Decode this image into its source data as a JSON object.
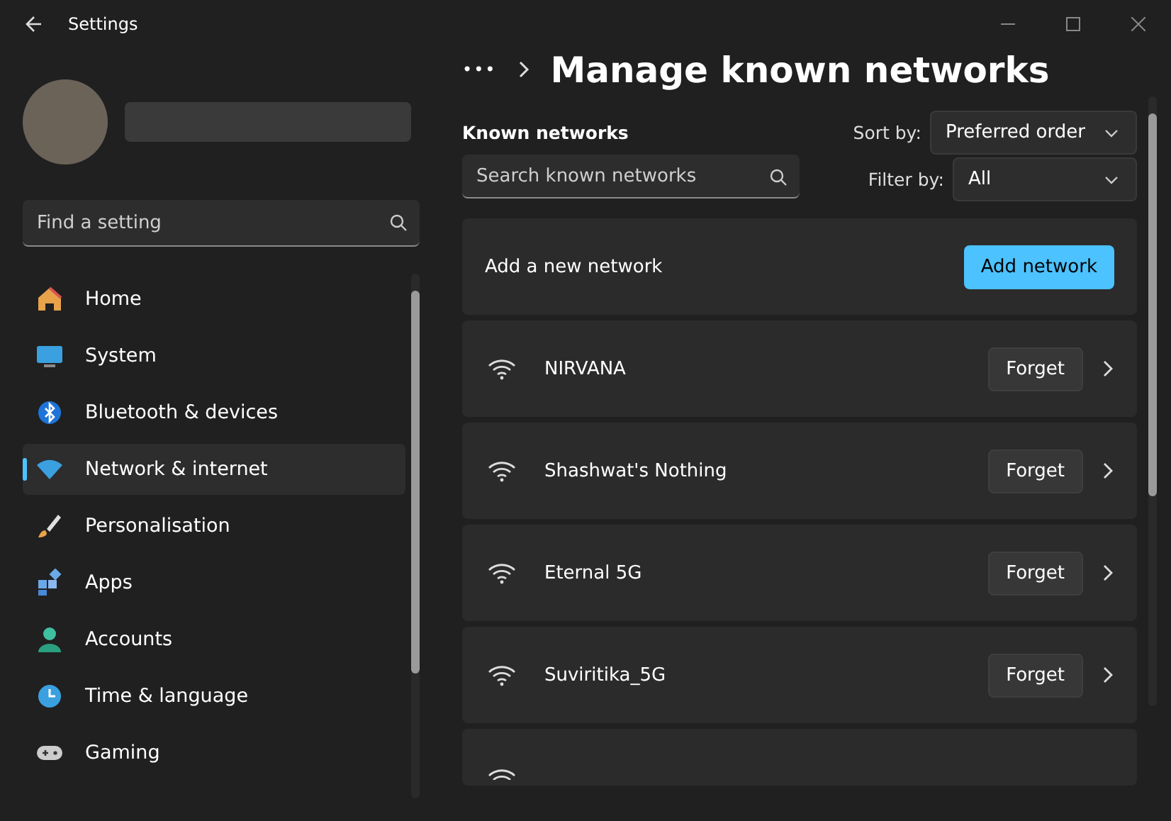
{
  "window": {
    "title": "Settings"
  },
  "search": {
    "placeholder": "Find a setting"
  },
  "sidebar": {
    "items": [
      {
        "label": "Home",
        "selected": false
      },
      {
        "label": "System",
        "selected": false
      },
      {
        "label": "Bluetooth & devices",
        "selected": false
      },
      {
        "label": "Network & internet",
        "selected": true
      },
      {
        "label": "Personalisation",
        "selected": false
      },
      {
        "label": "Apps",
        "selected": false
      },
      {
        "label": "Accounts",
        "selected": false
      },
      {
        "label": "Time & language",
        "selected": false
      },
      {
        "label": "Gaming",
        "selected": false
      }
    ]
  },
  "breadcrumb": {
    "more": "•••",
    "title": "Manage known networks"
  },
  "known_networks": {
    "heading": "Known networks",
    "search_placeholder": "Search known networks",
    "sort": {
      "label": "Sort by:",
      "value": "Preferred order"
    },
    "filter": {
      "label": "Filter by:",
      "value": "All"
    },
    "add": {
      "label": "Add a new network",
      "button": "Add network"
    },
    "networks": [
      {
        "name": "NIRVANA",
        "button": "Forget"
      },
      {
        "name": "Shashwat's Nothing",
        "button": "Forget"
      },
      {
        "name": "Eternal 5G",
        "button": "Forget"
      },
      {
        "name": "Suviritika_5G",
        "button": "Forget"
      }
    ]
  }
}
